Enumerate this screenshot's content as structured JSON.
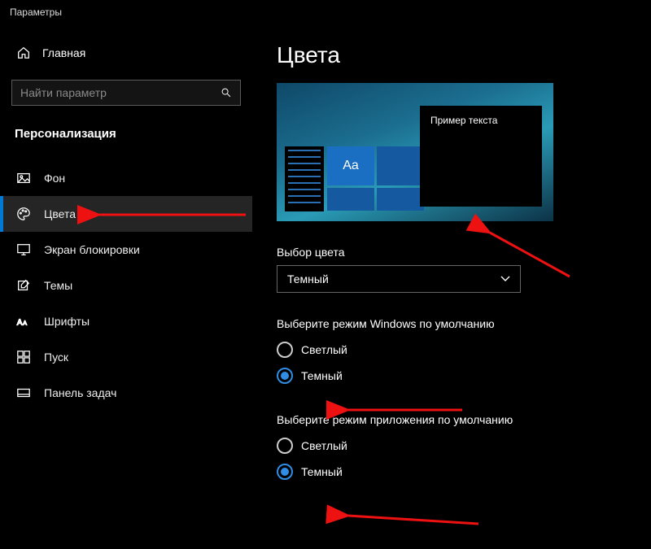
{
  "window_title": "Параметры",
  "sidebar": {
    "home_label": "Главная",
    "search_placeholder": "Найти параметр",
    "category": "Персонализация",
    "items": [
      {
        "icon": "image-icon",
        "label": "Фон"
      },
      {
        "icon": "palette-icon",
        "label": "Цвета"
      },
      {
        "icon": "monitor-icon",
        "label": "Экран блокировки"
      },
      {
        "icon": "pencil-icon",
        "label": "Темы"
      },
      {
        "icon": "font-icon",
        "label": "Шрифты"
      },
      {
        "icon": "start-icon",
        "label": "Пуск"
      },
      {
        "icon": "taskbar-icon",
        "label": "Панель задач"
      }
    ],
    "active_index": 1
  },
  "main": {
    "heading": "Цвета",
    "preview_sample_text": "Пример текста",
    "preview_tile_text": "Aa",
    "color_mode_label": "Выбор цвета",
    "color_mode_value": "Темный",
    "windows_mode_label": "Выберите режим Windows по умолчанию",
    "windows_mode_options": [
      "Светлый",
      "Темный"
    ],
    "windows_mode_selected": 1,
    "app_mode_label": "Выберите режим приложения по умолчанию",
    "app_mode_options": [
      "Светлый",
      "Темный"
    ],
    "app_mode_selected": 1
  },
  "accent_color": "#0078d4"
}
